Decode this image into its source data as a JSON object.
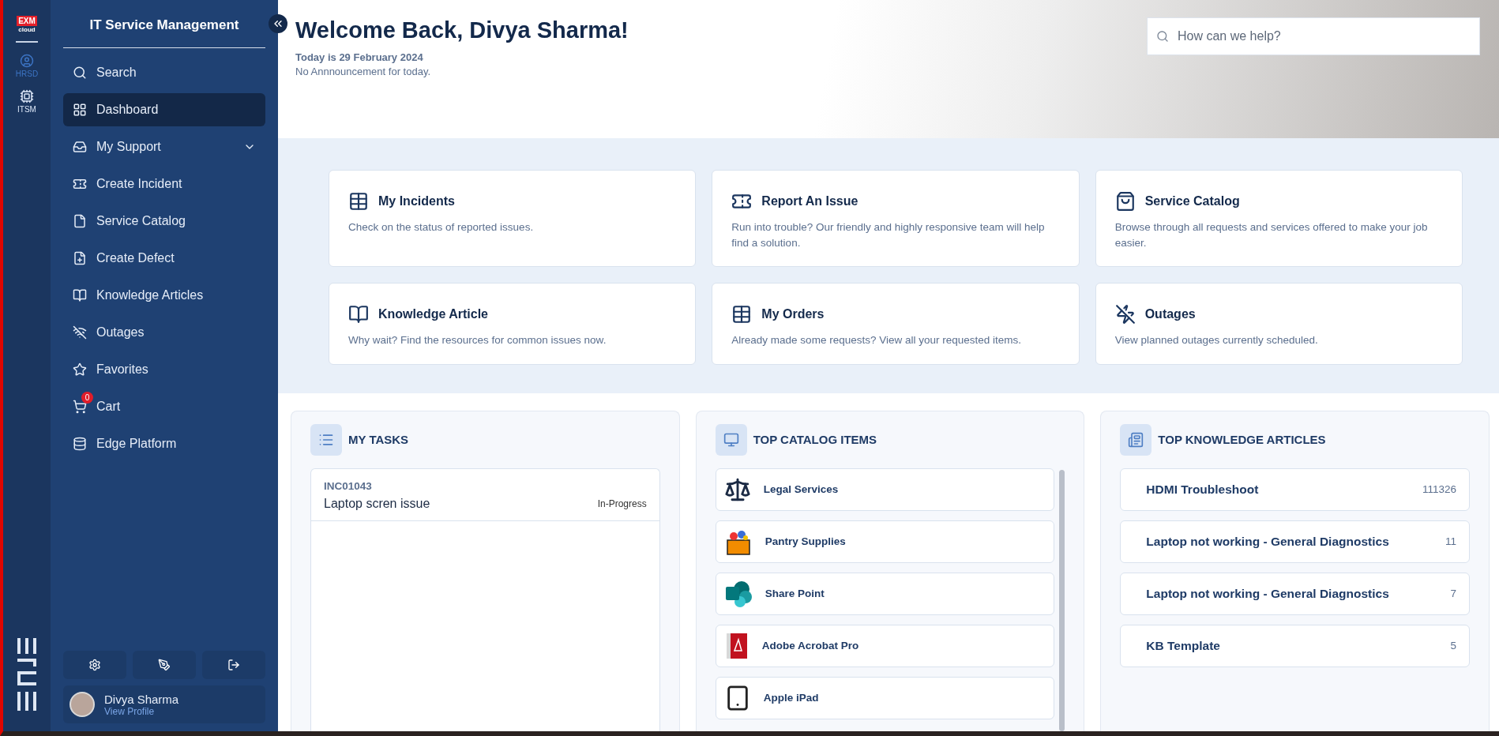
{
  "rail": {
    "logo_top": "EXM",
    "logo_bottom": "cloud",
    "apps": [
      {
        "label": "HRSD",
        "selected": false
      },
      {
        "label": "ITSM",
        "selected": true
      }
    ]
  },
  "sidebar": {
    "title": "IT Service Management",
    "items": [
      {
        "label": "Search",
        "selected": false
      },
      {
        "label": "Dashboard",
        "selected": true
      },
      {
        "label": "My Support",
        "selected": false,
        "expandable": true
      },
      {
        "label": "Create Incident",
        "selected": false
      },
      {
        "label": "Service Catalog",
        "selected": false
      },
      {
        "label": "Create Defect",
        "selected": false
      },
      {
        "label": "Knowledge Articles",
        "selected": false
      },
      {
        "label": "Outages",
        "selected": false
      },
      {
        "label": "Favorites",
        "selected": false
      },
      {
        "label": "Cart",
        "selected": false,
        "badge": "0"
      },
      {
        "label": "Edge Platform",
        "selected": false
      }
    ],
    "user": {
      "name": "Divya Sharma",
      "link": "View Profile"
    }
  },
  "header": {
    "title": "Welcome Back, Divya Sharma!",
    "date": "Today is 29 February 2024",
    "announcement": "No Annnouncement for today.",
    "search": {
      "placeholder": "How can we help?"
    }
  },
  "cards": [
    {
      "title": "My Incidents",
      "text": "Check on the status of reported issues."
    },
    {
      "title": "Report An Issue",
      "text": "Run into trouble? Our friendly and highly responsive team will help find a solution."
    },
    {
      "title": "Service Catalog",
      "text": "Browse through all requests and services offered to make your job easier."
    },
    {
      "title": "Knowledge Article",
      "text": "Why wait? Find the resources for common issues now."
    },
    {
      "title": "My Orders",
      "text": "Already made some requests? View all your requested items."
    },
    {
      "title": "Outages",
      "text": "View planned outages currently scheduled."
    }
  ],
  "tasks": {
    "title": "MY TASKS",
    "items": [
      {
        "number": "INC01043",
        "title": "Laptop scren issue",
        "status": "In-Progress"
      }
    ]
  },
  "catalog": {
    "title": "TOP CATALOG ITEMS",
    "items": [
      {
        "name": "Legal Services"
      },
      {
        "name": "Pantry Supplies"
      },
      {
        "name": "Share Point"
      },
      {
        "name": "Adobe Acrobat Pro"
      },
      {
        "name": "Apple iPad"
      }
    ]
  },
  "articles": {
    "title": "TOP KNOWLEDGE ARTICLES",
    "items": [
      {
        "title": "HDMI Troubleshoot",
        "count": "111326"
      },
      {
        "title": "Laptop not working - General Diagnostics",
        "count": "11"
      },
      {
        "title": "Laptop not working - General Diagnostics",
        "count": "7"
      },
      {
        "title": "KB Template",
        "count": "5"
      }
    ]
  }
}
